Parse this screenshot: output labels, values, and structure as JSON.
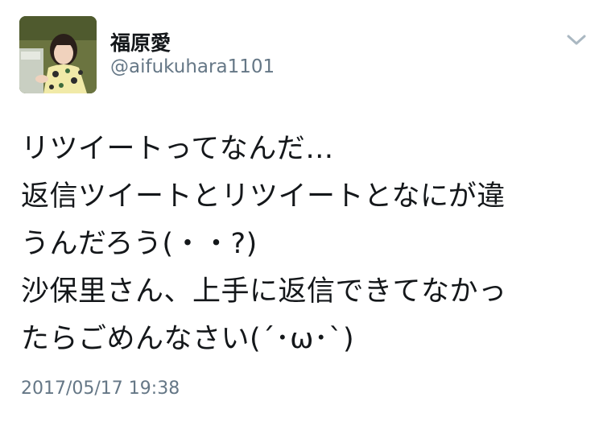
{
  "user": {
    "display_name": "福原愛",
    "handle": "@aifukuhara1101",
    "avatar_icon": "profile-photo"
  },
  "tweet": {
    "lines": [
      "リツイートってなんだ…",
      "返信ツイートとリツイートとなにが違",
      "うんだろう(・・?)",
      "沙保里さん、上手に返信できてなかっ",
      "たらごめんなさい(´･ω･`)"
    ],
    "timestamp": "2017/05/17 19:38"
  },
  "menu": {
    "icon": "chevron-down-icon"
  },
  "colors": {
    "text": "#14171a",
    "secondary": "#657786",
    "chevron": "#aab8c2",
    "background": "#ffffff"
  }
}
